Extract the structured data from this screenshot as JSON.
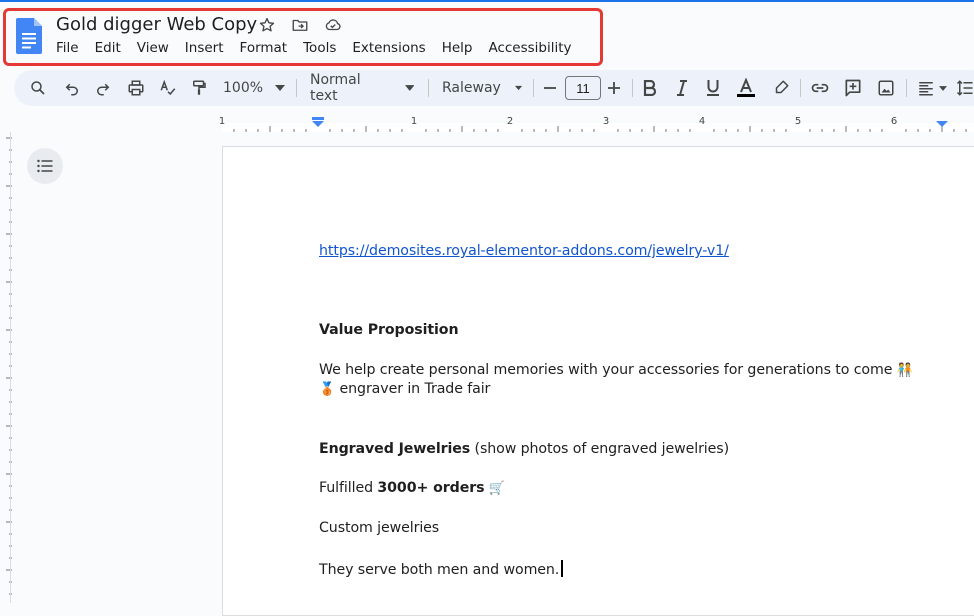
{
  "doc": {
    "title": "Gold digger Web Copy",
    "menu": [
      "File",
      "Edit",
      "View",
      "Insert",
      "Format",
      "Tools",
      "Extensions",
      "Help",
      "Accessibility"
    ]
  },
  "toolbar": {
    "zoom": "100%",
    "style": "Normal text",
    "font": "Raleway",
    "font_size": "11"
  },
  "ruler": {
    "labels": [
      "1",
      "1",
      "2",
      "3",
      "4",
      "5",
      "6"
    ]
  },
  "content": {
    "link": "https://demosites.royal-elementor-addons.com/jewelry-v1/",
    "value_heading": "Value Proposition",
    "value_line1": "We help create personal memories with your accessories for generations to come",
    "value_emoji1": "🧑‍🤝‍🧑",
    "value_emoji2": "🥉",
    "value_line2": "engraver in Trade fair",
    "engraved_bold": "Engraved Jewelries",
    "engraved_rest": " (show photos of engraved jewelries)",
    "fulfilled_prefix": "Fulfilled ",
    "fulfilled_bold": "3000+ orders",
    "fulfilled_emoji": "🛒",
    "custom": "Custom jewelries",
    "serve": "They serve both men and women."
  },
  "colors": {
    "accent": "#1a73e8",
    "highlight": "#e53935",
    "link": "#1155cc"
  }
}
